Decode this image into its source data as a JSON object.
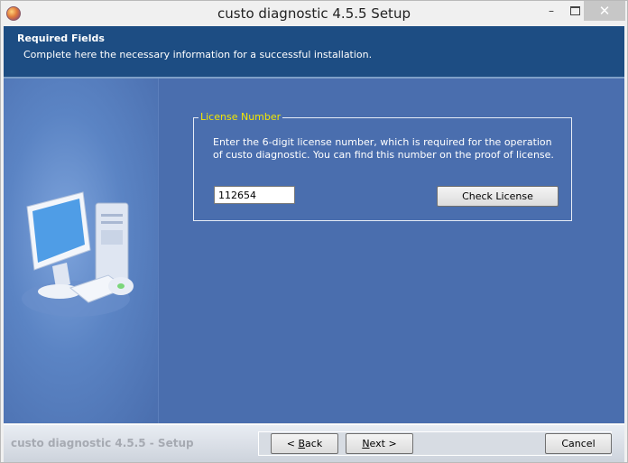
{
  "window": {
    "title": "custo diagnostic 4.5.5 Setup"
  },
  "titlebar": {
    "minimize_glyph": "–",
    "close_glyph": "✕"
  },
  "header": {
    "title": "Required Fields",
    "subtitle": "Complete here the necessary information for a successful installation."
  },
  "license_group": {
    "legend": "License Number",
    "description": "Enter the 6-digit license number, which is required for the operation of custo diagnostic. You can find this number on the proof of license.",
    "input_value": "112654",
    "check_button": "Check License"
  },
  "footer": {
    "brand": "custo diagnostic 4.5.5 - Setup",
    "back": {
      "prefix": "< ",
      "mnemonic": "B",
      "rest": "ack"
    },
    "next": {
      "mnemonic": "N",
      "rest": "ext >"
    },
    "cancel": "Cancel"
  },
  "icons": [
    "app-icon",
    "minimize-icon",
    "maximize-icon",
    "close-icon",
    "computer-illustration"
  ],
  "colors": {
    "header_bg": "#1d4d83",
    "panel_bg": "#4a6eae",
    "legend_text": "#f2e600"
  }
}
